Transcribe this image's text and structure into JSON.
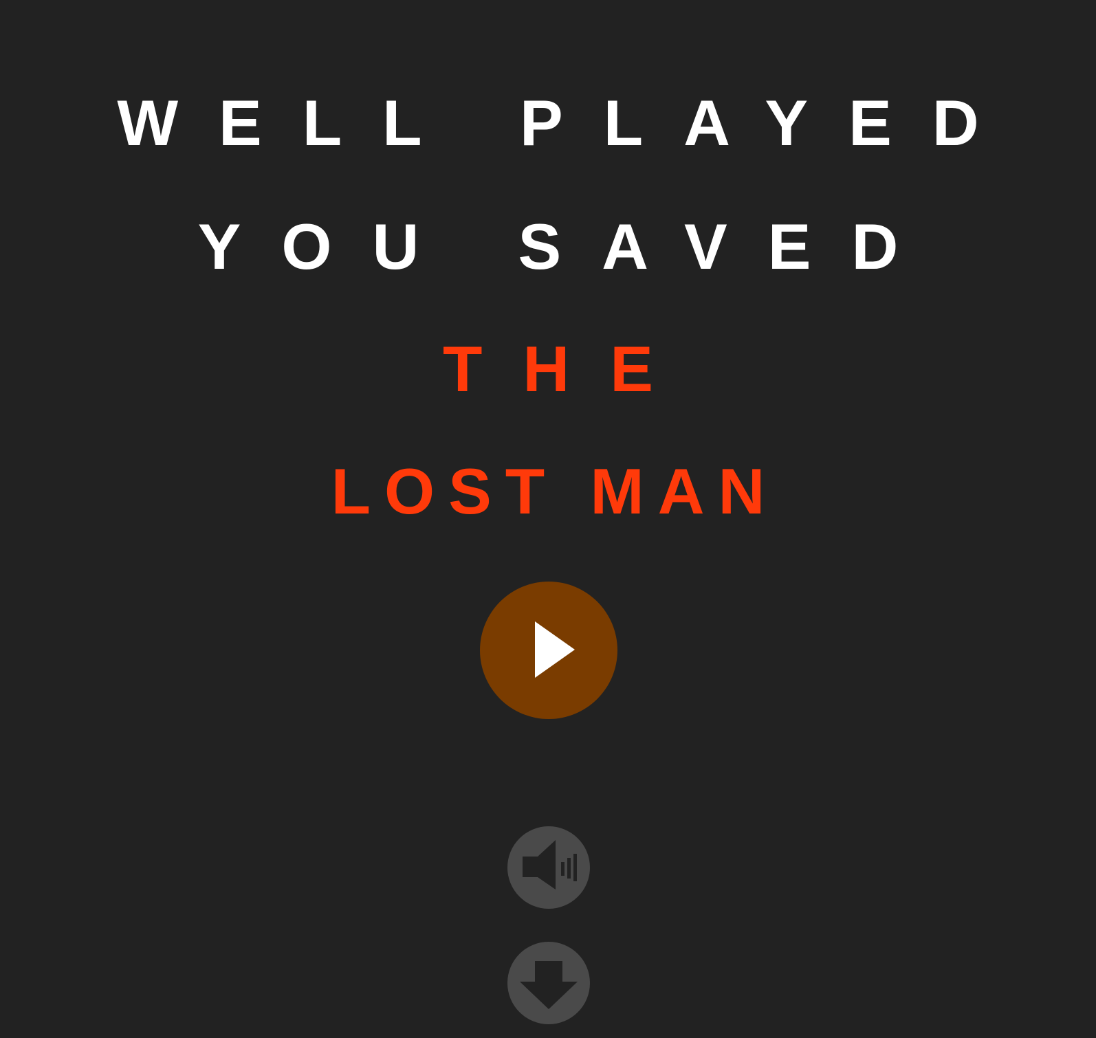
{
  "end_screen": {
    "line_1": "WELL PLAYED",
    "line_2": "YOU SAVED",
    "line_3": "THE",
    "line_4": "LOST MAN"
  },
  "colors": {
    "background": "#222222",
    "heading_white": "#ffffff",
    "heading_red": "#ff3a0a",
    "play_button": "#7a3c00",
    "secondary_button": "#4a4a4a",
    "secondary_icon": "#222222"
  },
  "icons": {
    "play": "play-icon",
    "sound": "speaker-icon",
    "download": "arrow-down-icon"
  }
}
